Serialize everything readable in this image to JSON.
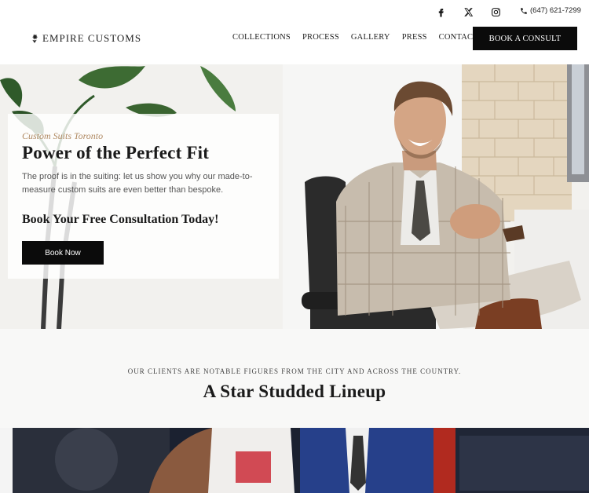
{
  "topbar": {
    "icons": [
      "facebook-icon",
      "x-twitter-icon",
      "instagram-icon",
      "phone-icon"
    ],
    "phone": "(647) 621-7299"
  },
  "header": {
    "logo_text": "EMPIRE CUSTOMS",
    "nav": [
      "COLLECTIONS",
      "PROCESS",
      "GALLERY",
      "PRESS",
      "CONTACT"
    ],
    "cta": "BOOK A CONSULT"
  },
  "hero": {
    "eyebrow": "Custom Suits Toronto",
    "title": "Power of the Perfect Fit",
    "text": "The proof is in the suiting: let us show you why our made-to-measure custom suits are even better than bespoke.",
    "subheading": "Book Your Free Consultation Today!",
    "button": "Book Now"
  },
  "lineup": {
    "eyebrow": "OUR CLIENTS ARE NOTABLE FIGURES FROM THE CITY AND ACROSS THE COUNTRY.",
    "title": "A Star Studded Lineup"
  },
  "colors": {
    "accent_gold": "#b08a63",
    "button_black": "#0b0b0b",
    "text_dark": "#1a1a1a"
  }
}
